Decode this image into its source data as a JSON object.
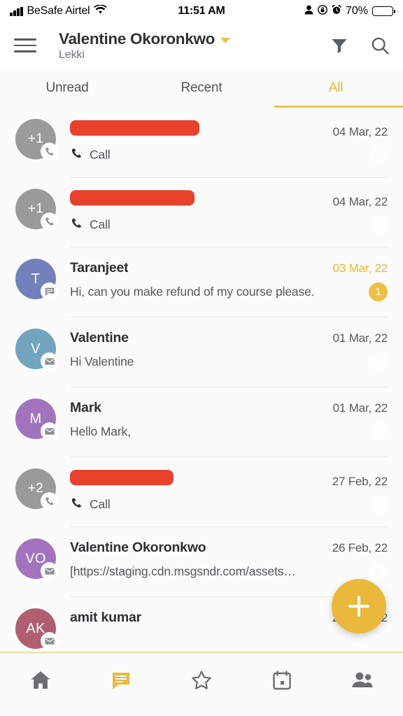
{
  "status_bar": {
    "carrier": "BeSafe Airtel",
    "time": "11:51 AM",
    "battery_percent": "70%",
    "icons": [
      "signal-bars-icon",
      "wifi-icon",
      "person-icon",
      "rotation-lock-icon",
      "alarm-clock-icon",
      "battery-icon"
    ]
  },
  "header": {
    "menu_icon": "hamburger-menu-icon",
    "title": "Valentine Okoronkwo",
    "subtitle": "Lekki",
    "dropdown_icon": "chevron-down-icon",
    "filter_icon": "filter-funnel-icon",
    "search_icon": "search-icon"
  },
  "tabs": {
    "items": [
      {
        "label": "Unread",
        "active": false
      },
      {
        "label": "Recent",
        "active": false
      },
      {
        "label": "All",
        "active": true
      }
    ]
  },
  "conversations": [
    {
      "name": "",
      "redacted": true,
      "redact_class": "r1",
      "initials": "+1",
      "avatar_color": "#9a9a9a",
      "channel_icon": "phone-icon",
      "preview": "Call",
      "preview_icon": "phone-icon",
      "date": "04 Mar, 22",
      "date_unread": false,
      "count": "0",
      "count_zero": true
    },
    {
      "name": "",
      "redacted": true,
      "redact_class": "r2",
      "initials": "+1",
      "avatar_color": "#9a9a9a",
      "channel_icon": "phone-icon",
      "preview": "Call",
      "preview_icon": "phone-icon",
      "date": "04 Mar, 22",
      "date_unread": false,
      "count": "0",
      "count_zero": true
    },
    {
      "name": "Taranjeet",
      "redacted": false,
      "redact_class": "",
      "initials": "T",
      "avatar_color": "#7281bb",
      "channel_icon": "chat-bubble-icon",
      "preview": "Hi, can you make refund of my course please.",
      "preview_icon": "",
      "date": "03 Mar, 22",
      "date_unread": true,
      "count": "1",
      "count_zero": false
    },
    {
      "name": "Valentine",
      "redacted": false,
      "redact_class": "",
      "initials": "V",
      "avatar_color": "#72a5bd",
      "channel_icon": "envelope-icon",
      "preview": "Hi Valentine",
      "preview_icon": "",
      "date": "01 Mar, 22",
      "date_unread": false,
      "count": "0",
      "count_zero": true
    },
    {
      "name": "Mark",
      "redacted": false,
      "redact_class": "",
      "initials": "M",
      "avatar_color": "#a173bd",
      "channel_icon": "envelope-icon",
      "preview": "Hello Mark,",
      "preview_icon": "",
      "date": "01 Mar, 22",
      "date_unread": false,
      "count": "0",
      "count_zero": true
    },
    {
      "name": "",
      "redacted": true,
      "redact_class": "r3",
      "initials": "+2",
      "avatar_color": "#9a9a9a",
      "channel_icon": "phone-icon",
      "preview": "Call",
      "preview_icon": "phone-icon",
      "date": "27 Feb, 22",
      "date_unread": false,
      "count": "0",
      "count_zero": true
    },
    {
      "name": "Valentine Okoronkwo",
      "redacted": false,
      "redact_class": "",
      "initials": "VO",
      "avatar_color": "#a373c0",
      "channel_icon": "envelope-icon",
      "preview": "[https://staging.cdn.msgsndr.com/assets…",
      "preview_icon": "",
      "date": "26 Feb, 22",
      "date_unread": false,
      "count": "0",
      "count_zero": true
    },
    {
      "name": "amit kumar",
      "redacted": false,
      "redact_class": "",
      "initials": "AK",
      "avatar_color": "#b05f71",
      "channel_icon": "envelope-icon",
      "preview": "",
      "preview_icon": "",
      "date": "21 Feb, 22",
      "date_unread": false,
      "count": "",
      "count_zero": true
    }
  ],
  "fab": {
    "icon": "plus-icon",
    "color": "#eab93b"
  },
  "bottom_nav": {
    "items": [
      {
        "icon": "home-icon",
        "active": false
      },
      {
        "icon": "chat-bubble-icon",
        "active": true
      },
      {
        "icon": "star-icon",
        "active": false
      },
      {
        "icon": "calendar-icon",
        "active": false
      },
      {
        "icon": "contacts-people-icon",
        "active": false
      }
    ]
  },
  "colors": {
    "accent": "#eab93b",
    "redaction": "#e8412c",
    "text_primary": "#2d3134",
    "text_secondary": "#53585c",
    "background": "#fbfbfb"
  }
}
